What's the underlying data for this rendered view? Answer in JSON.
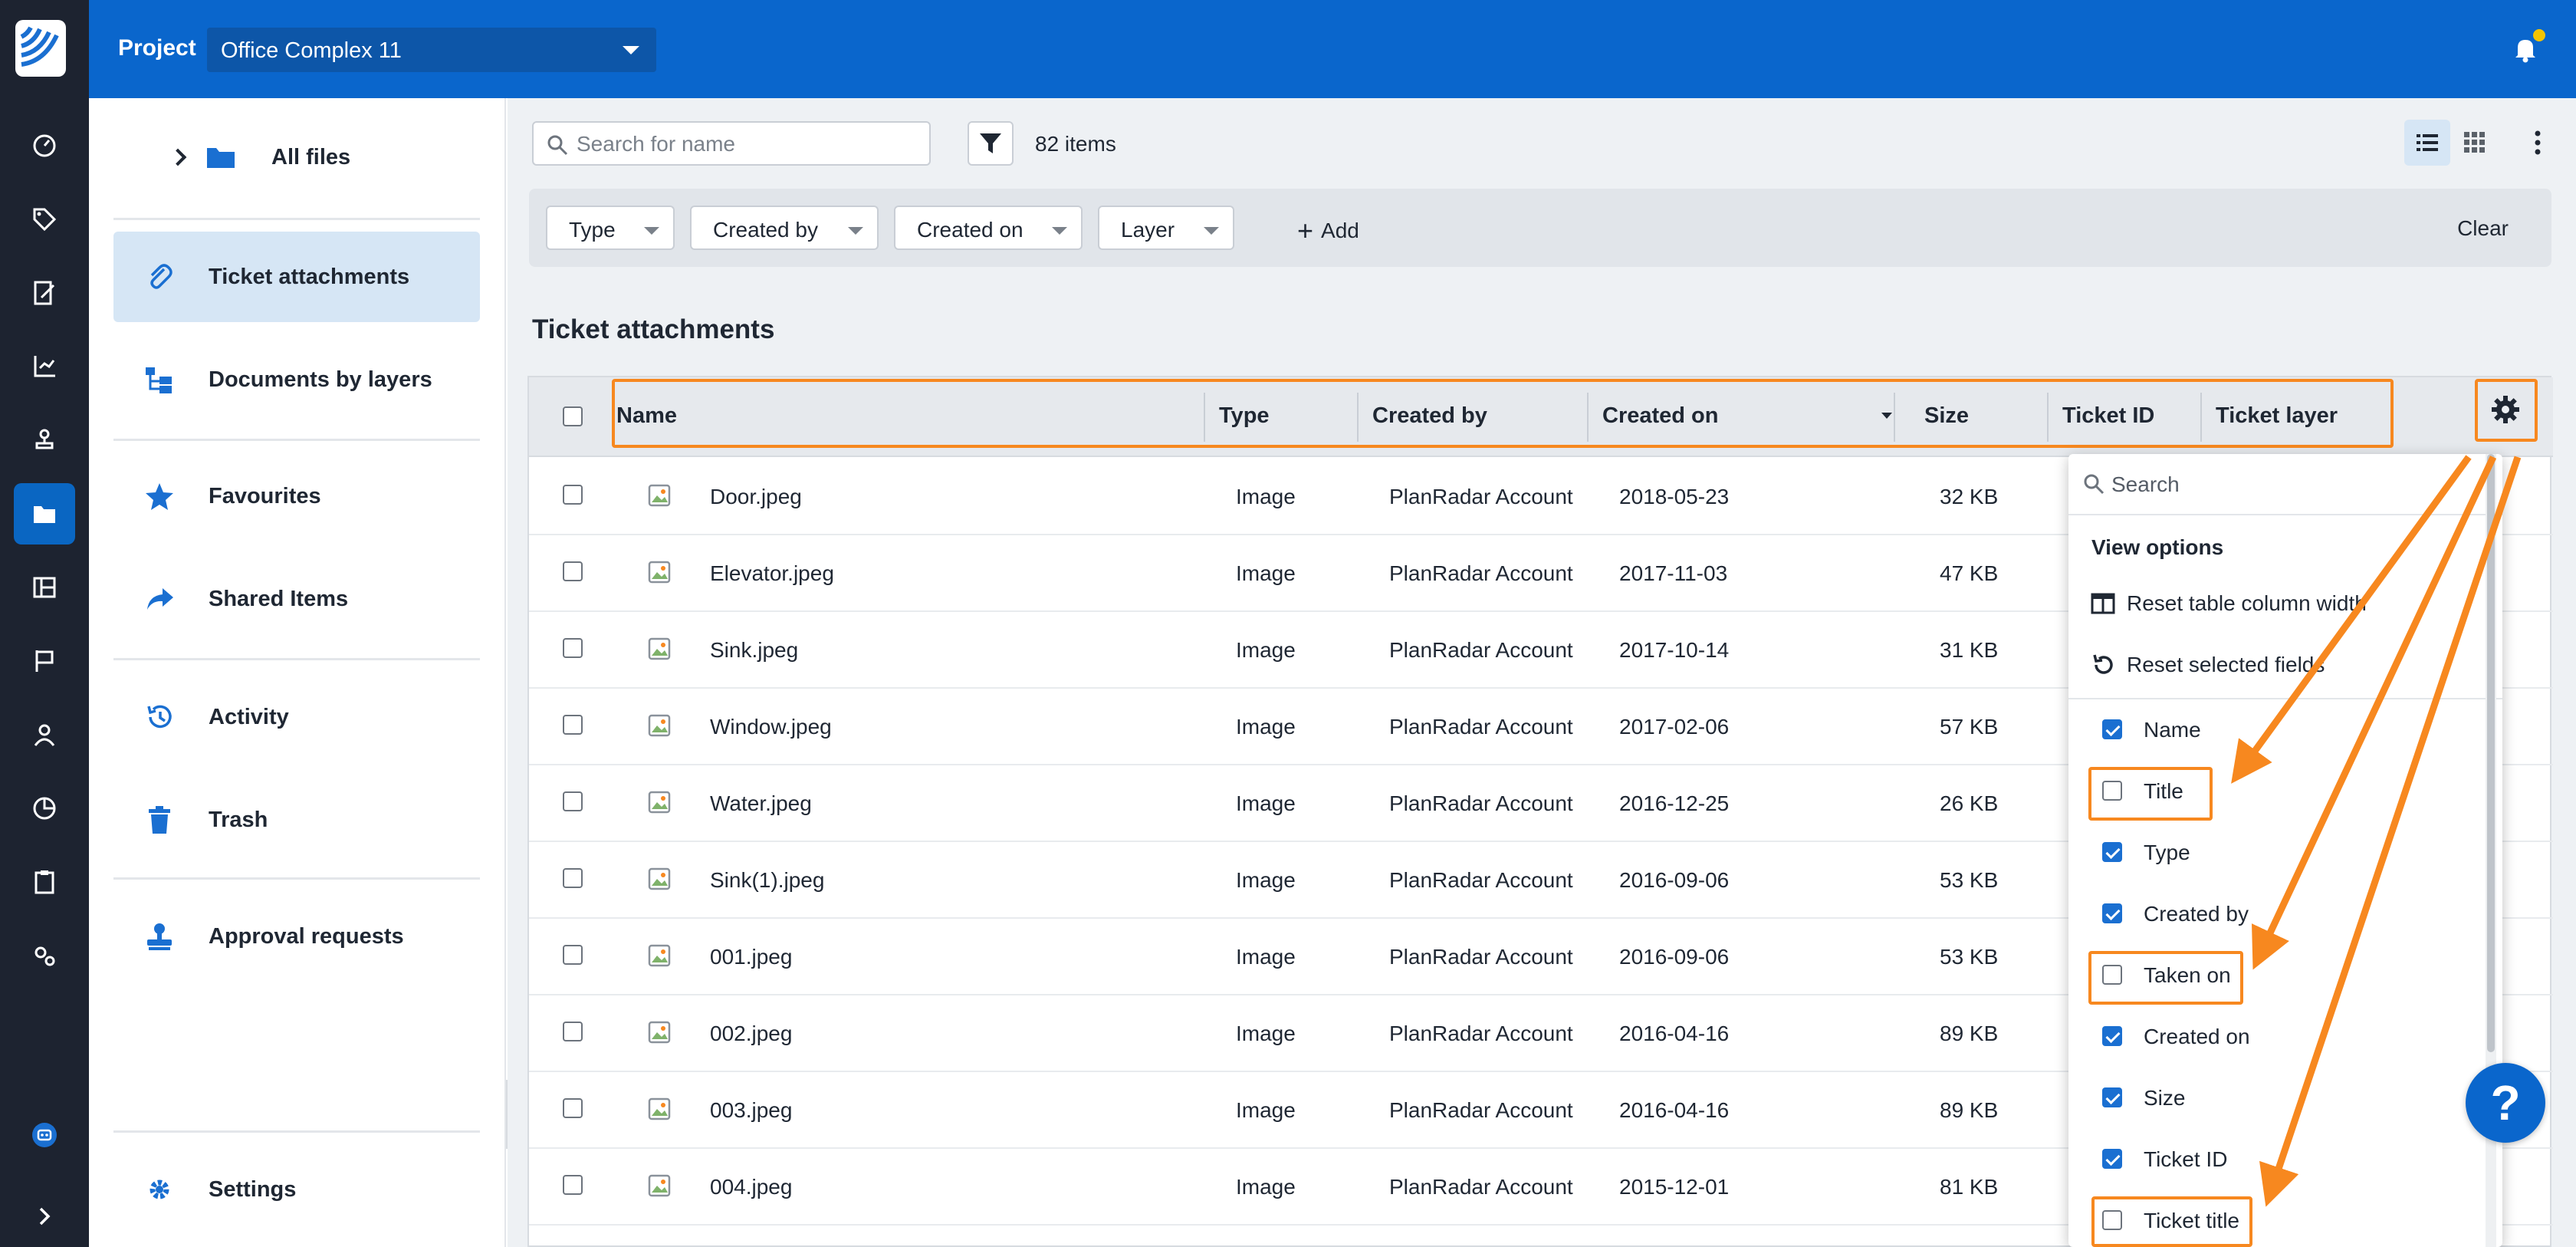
{
  "topbar": {
    "project_label": "Project",
    "project_value": "Office Complex 11"
  },
  "rail": {
    "items": [
      "dashboard-icon",
      "tag-icon",
      "edit-document-icon",
      "chart-icon",
      "stamp-icon",
      "folder-icon",
      "plans-icon",
      "flag-icon",
      "user-icon",
      "pie-chart-icon",
      "clipboard-icon",
      "settings-cogs-icon"
    ],
    "active": "folder-icon"
  },
  "sidenav": {
    "all_files": "All files",
    "ticket_attachments": "Ticket attachments",
    "documents_by_layers": "Documents by layers",
    "favourites": "Favourites",
    "shared_items": "Shared Items",
    "activity": "Activity",
    "trash": "Trash",
    "approval_requests": "Approval requests",
    "settings": "Settings"
  },
  "toolbar": {
    "search_placeholder": "Search for name",
    "items_count": "82 items"
  },
  "filters": {
    "type": "Type",
    "created_by": "Created by",
    "created_on": "Created on",
    "layer": "Layer",
    "add": "Add",
    "clear": "Clear"
  },
  "section_title": "Ticket attachments",
  "table": {
    "headers": {
      "name": "Name",
      "type": "Type",
      "created_by": "Created by",
      "created_on": "Created on",
      "size": "Size",
      "ticket_id": "Ticket ID",
      "ticket_layer": "Ticket layer"
    },
    "rows": [
      {
        "name": "Door.jpeg",
        "type": "Image",
        "created_by": "PlanRadar Account",
        "created_on": "2018-05-23",
        "size": "32 KB"
      },
      {
        "name": "Elevator.jpeg",
        "type": "Image",
        "created_by": "PlanRadar Account",
        "created_on": "2017-11-03",
        "size": "47 KB"
      },
      {
        "name": "Sink.jpeg",
        "type": "Image",
        "created_by": "PlanRadar Account",
        "created_on": "2017-10-14",
        "size": "31 KB"
      },
      {
        "name": "Window.jpeg",
        "type": "Image",
        "created_by": "PlanRadar Account",
        "created_on": "2017-02-06",
        "size": "57 KB"
      },
      {
        "name": "Water.jpeg",
        "type": "Image",
        "created_by": "PlanRadar Account",
        "created_on": "2016-12-25",
        "size": "26 KB"
      },
      {
        "name": "Sink(1).jpeg",
        "type": "Image",
        "created_by": "PlanRadar Account",
        "created_on": "2016-09-06",
        "size": "53 KB"
      },
      {
        "name": "001.jpeg",
        "type": "Image",
        "created_by": "PlanRadar Account",
        "created_on": "2016-09-06",
        "size": "53 KB"
      },
      {
        "name": "002.jpeg",
        "type": "Image",
        "created_by": "PlanRadar Account",
        "created_on": "2016-04-16",
        "size": "89 KB"
      },
      {
        "name": "003.jpeg",
        "type": "Image",
        "created_by": "PlanRadar Account",
        "created_on": "2016-04-16",
        "size": "89 KB"
      },
      {
        "name": "004.jpeg",
        "type": "Image",
        "created_by": "PlanRadar Account",
        "created_on": "2015-12-01",
        "size": "81 KB"
      }
    ]
  },
  "panel": {
    "search_placeholder": "Search",
    "heading": "View options",
    "reset_width": "Reset table column width",
    "reset_fields": "Reset selected fields",
    "options": [
      {
        "label": "Name",
        "checked": true
      },
      {
        "label": "Title",
        "checked": false
      },
      {
        "label": "Type",
        "checked": true
      },
      {
        "label": "Created by",
        "checked": true
      },
      {
        "label": "Taken on",
        "checked": false
      },
      {
        "label": "Created on",
        "checked": true
      },
      {
        "label": "Size",
        "checked": true
      },
      {
        "label": "Ticket ID",
        "checked": true
      },
      {
        "label": "Ticket title",
        "checked": false
      }
    ]
  },
  "help_label": "?",
  "colors": {
    "topbar": "#0a66cc",
    "rail": "#1d2330",
    "accent": "#0a66c2",
    "highlight": "#f7881f",
    "active_nav": "#d6e6f5"
  }
}
